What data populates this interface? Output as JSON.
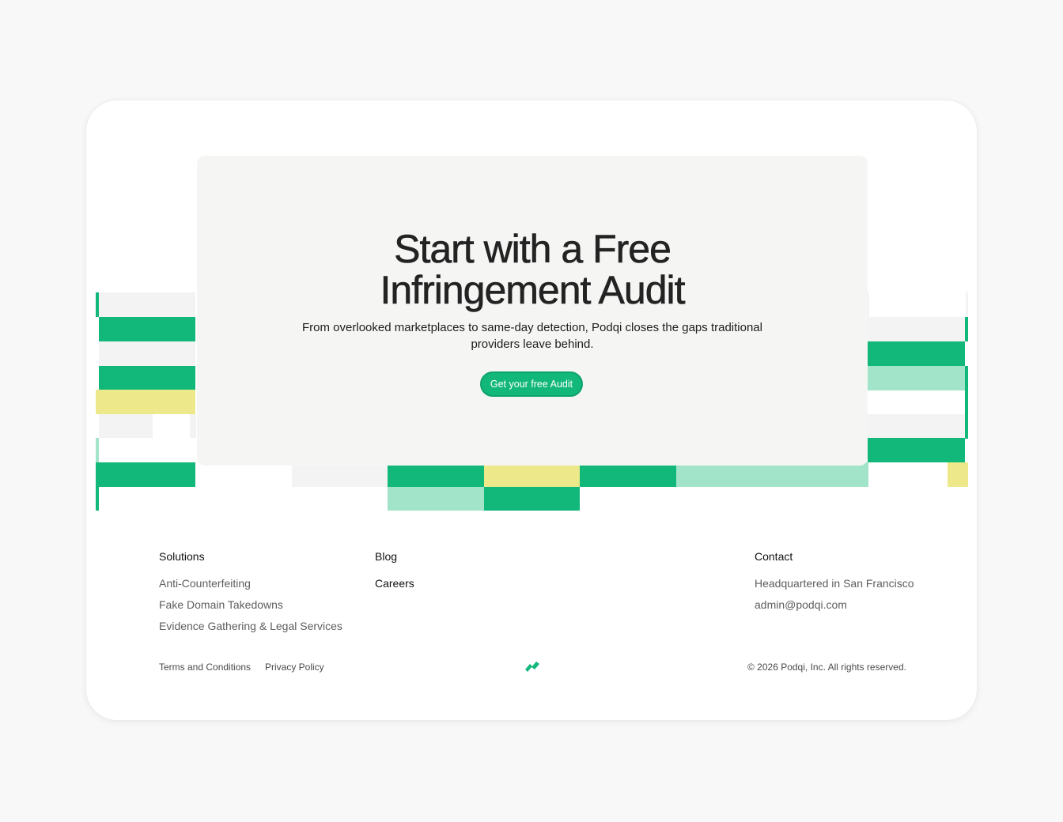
{
  "hero": {
    "title_line1": "Start with a Free",
    "title_line2": "Infringement Audit",
    "subtitle": "From overlooked marketplaces to same-day detection, Podqi closes the gaps traditional providers leave behind.",
    "cta_label": "Get your free Audit"
  },
  "footer": {
    "solutions": {
      "heading": "Solutions",
      "links": [
        "Anti-Counterfeiting",
        "Fake Domain Takedowns",
        "Evidence Gathering & Legal Services"
      ]
    },
    "blog_label": "Blog",
    "careers_label": "Careers",
    "contact": {
      "heading": "Contact",
      "location": "Headquartered in San Francisco",
      "email": "admin@podqi.com"
    },
    "terms_label": "Terms and Conditions",
    "privacy_label": "Privacy Policy",
    "copyright": "© 2026 Podqi, Inc. All rights reserved.",
    "logo_icon": "podqi-logo-icon"
  },
  "colors": {
    "accent": "#12b77a",
    "mint": "#a2e4c9",
    "yellow": "#ede98a",
    "gray": "#f3f3f3"
  }
}
